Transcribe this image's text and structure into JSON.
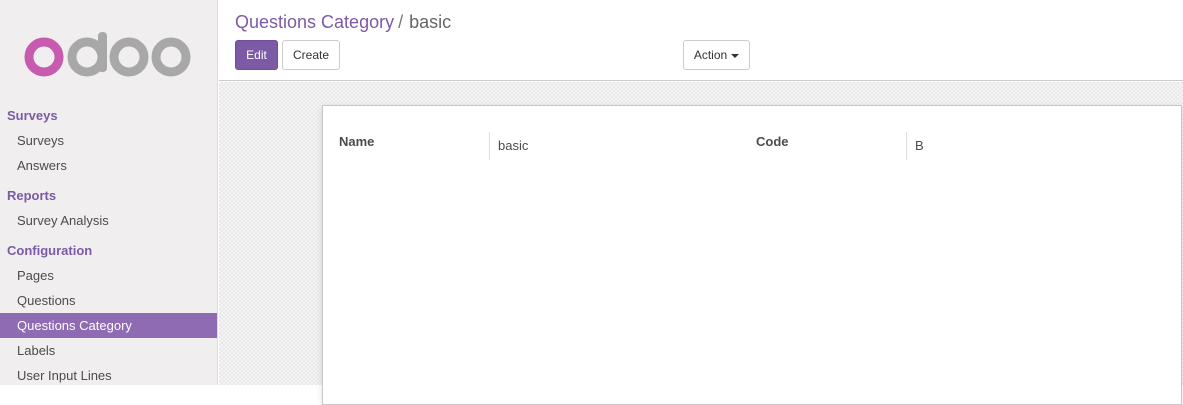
{
  "sidebar": {
    "logo_text": "odoo",
    "sections": [
      {
        "title": "Surveys",
        "items": [
          "Surveys",
          "Answers"
        ]
      },
      {
        "title": "Reports",
        "items": [
          "Survey Analysis"
        ]
      },
      {
        "title": "Configuration",
        "items": [
          "Pages",
          "Questions",
          "Questions Category",
          "Labels",
          "User Input Lines"
        ]
      }
    ],
    "active_item": "Questions Category"
  },
  "breadcrumb": {
    "parent": "Questions Category",
    "separator": "/",
    "current": "basic"
  },
  "toolbar": {
    "edit_label": "Edit",
    "create_label": "Create",
    "action_label": "Action"
  },
  "form": {
    "name_label": "Name",
    "name_value": "basic",
    "code_label": "Code",
    "code_value": "B"
  },
  "colors": {
    "accent": "#7c5aa6",
    "active_menu_bg": "#8f6bb3",
    "logo_pink": "#c75bb0",
    "logo_grey": "#a8a8a8"
  }
}
